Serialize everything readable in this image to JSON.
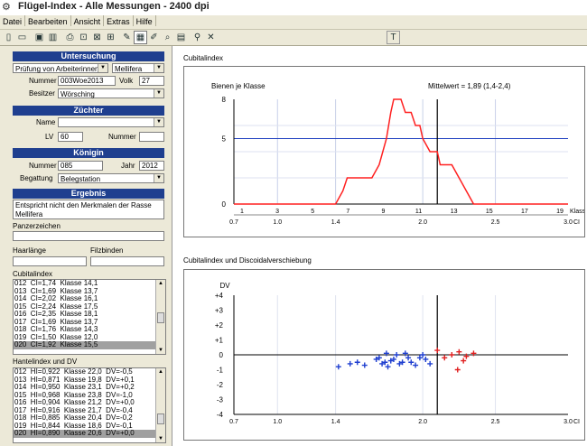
{
  "window": {
    "title": "Flügel-Index - Alle Messungen - 2400 dpi"
  },
  "menu": [
    "Datei",
    "Bearbeiten",
    "Ansicht",
    "Extras",
    "Hilfe"
  ],
  "toolbar": {
    "text_tool": "T"
  },
  "untersuchung": {
    "header": "Untersuchung",
    "pruefung": "Prüfung von Arbeiterinnen",
    "rasse": "Mellifera",
    "nummer_label": "Nummer",
    "nummer": "003Woe2013",
    "volk_label": "Volk",
    "volk": "27",
    "besitzer_label": "Besitzer",
    "besitzer": "Wörsching"
  },
  "zuechter": {
    "header": "Züchter",
    "name_label": "Name",
    "name": "",
    "lv_label": "LV",
    "lv": "60",
    "nummer_label": "Nummer",
    "nummer": ""
  },
  "koenigin": {
    "header": "Königin",
    "nummer_label": "Nummer",
    "nummer": "085",
    "jahr_label": "Jahr",
    "jahr": "2012",
    "begattung_label": "Begattung",
    "begattung": "Belegstation"
  },
  "ergebnis": {
    "header": "Ergebnis",
    "text": "Entspricht nicht den Merkmalen der Rasse Mellifera",
    "panzerzeichen_label": "Panzerzeichen",
    "panzerzeichen": "",
    "haarlaenge_label": "Haarlänge",
    "haarlaenge": "",
    "filzbinden_label": "Filzbinden",
    "filzbinden": ""
  },
  "cubitalindex_list": {
    "label": "Cubitalindex",
    "rows": [
      "012  CI=1,74  Klasse 14,1",
      "013  CI=1,69  Klasse 13,7",
      "014  CI=2,02  Klasse 16,1",
      "015  CI=2,24  Klasse 17,5",
      "016  CI=2,35  Klasse 18,1",
      "017  CI=1,69  Klasse 13,7",
      "018  CI=1,76  Klasse 14,3",
      "019  CI=1,50  Klasse 12,0",
      "020  CI=1,92  Klasse 15,5"
    ]
  },
  "hantelindex_list": {
    "label": "Hantelindex und DV",
    "rows": [
      "012  HI=0,922  Klasse 22,0  DV=-0,5",
      "013  HI=0,871  Klasse 19,8  DV=+0,1",
      "014  HI=0,950  Klasse 23,1  DV=+0,2",
      "015  HI=0,968  Klasse 23,8  DV=-1,0",
      "016  HI=0,904  Klasse 21,2  DV=+0,0",
      "017  HI=0,916  Klasse 21,7  DV=-0,4",
      "018  HI=0,885  Klasse 20,4  DV=-0,2",
      "019  HI=0,844  Klasse 18,6  DV=-0,1",
      "020  HI=0,890  Klasse 20,6  DV=+0,0"
    ]
  },
  "chart_data": [
    {
      "type": "line",
      "panel_title": "Cubitalindex",
      "title": "",
      "ylabel": "Bienen je Klasse",
      "xlabel_right": "Klasse",
      "ci_label": "CI",
      "mean_label": "Mittelwert = 1,89 (1,4-2,4)",
      "klasse_ticks": [
        "1",
        "3",
        "5",
        "7",
        "9",
        "11",
        "13",
        "15",
        "17",
        "19"
      ],
      "ci_ticks": [
        "0.7",
        "1.0",
        "1.4",
        "2.0",
        "2.5",
        "3.0"
      ],
      "ci_tick_values": [
        0.7,
        1.0,
        1.4,
        2.0,
        2.5,
        3.0
      ],
      "y_ticks": [
        "0",
        "5",
        "8"
      ],
      "ylim": [
        0,
        8
      ],
      "reference_line_y": 5,
      "mean_ci": 2.1,
      "x_ci": [
        0.7,
        1.4,
        1.45,
        1.48,
        1.5,
        1.55,
        1.6,
        1.65,
        1.7,
        1.75,
        1.78,
        1.8,
        1.82,
        1.85,
        1.88,
        1.9,
        1.92,
        1.95,
        1.98,
        2.0,
        2.05,
        2.1,
        2.12,
        2.15,
        2.2,
        2.25,
        2.3,
        2.35,
        2.4,
        2.45,
        3.0
      ],
      "y": [
        0,
        0,
        1,
        2,
        2,
        2,
        2,
        2,
        3,
        5,
        7,
        8,
        8,
        8,
        7,
        7,
        7,
        6,
        6,
        5,
        4,
        4,
        3,
        3,
        3,
        2,
        1,
        0,
        0,
        0,
        0
      ]
    },
    {
      "type": "scatter",
      "panel_title": "Cubitalindex und Discoidalverschiebung",
      "title": "",
      "ylabel": "DV",
      "ci_label": "CI",
      "ci_ticks": [
        "0.7",
        "1.0",
        "1.4",
        "2.0",
        "2.5",
        "3.0"
      ],
      "ci_tick_values": [
        0.7,
        1.0,
        1.4,
        2.0,
        2.5,
        3.0
      ],
      "y_ticks": [
        "+4",
        "+3",
        "+2",
        "+1",
        "0",
        "-1",
        "-2",
        "-3",
        "-4"
      ],
      "ylim": [
        -4,
        4
      ],
      "mean_ci": 2.1,
      "series": [
        {
          "color": "#1f3fd0",
          "points": [
            [
              1.42,
              -0.8
            ],
            [
              1.5,
              -0.6
            ],
            [
              1.55,
              -0.5
            ],
            [
              1.6,
              -0.7
            ],
            [
              1.68,
              -0.3
            ],
            [
              1.7,
              -0.2
            ],
            [
              1.72,
              -0.6
            ],
            [
              1.74,
              -0.5
            ],
            [
              1.75,
              0.1
            ],
            [
              1.76,
              -0.8
            ],
            [
              1.78,
              -0.4
            ],
            [
              1.8,
              -0.3
            ],
            [
              1.82,
              0.0
            ],
            [
              1.84,
              -0.6
            ],
            [
              1.86,
              -0.5
            ],
            [
              1.88,
              0.1
            ],
            [
              1.9,
              -0.2
            ],
            [
              1.92,
              -0.5
            ],
            [
              1.95,
              -0.7
            ],
            [
              1.98,
              -0.2
            ],
            [
              2.0,
              0.0
            ],
            [
              2.02,
              -0.3
            ],
            [
              2.05,
              -0.6
            ]
          ]
        },
        {
          "color": "#e02020",
          "points": [
            [
              2.1,
              0.3
            ],
            [
              2.15,
              -0.2
            ],
            [
              2.2,
              0.0
            ],
            [
              2.24,
              -1.0
            ],
            [
              2.25,
              0.2
            ],
            [
              2.28,
              -0.4
            ],
            [
              2.3,
              -0.1
            ],
            [
              2.35,
              0.1
            ]
          ]
        }
      ]
    }
  ]
}
